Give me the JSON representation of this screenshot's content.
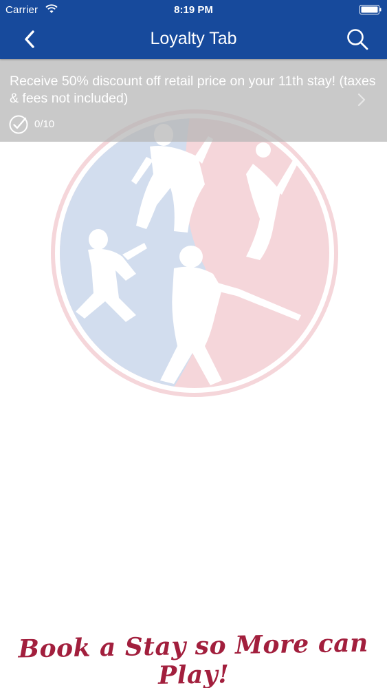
{
  "status_bar": {
    "carrier": "Carrier",
    "time": "8:19 PM"
  },
  "nav": {
    "title": "Loyalty Tab",
    "back_icon": "chevron-left-icon",
    "search_icon": "search-icon"
  },
  "offer": {
    "description": "Receive 50% discount off retail price on your 11th stay! (taxes & fees not included)",
    "progress_label": "0/10",
    "progress": {
      "completed": 0,
      "total": 10
    }
  },
  "slogan": "Book a Stay so More can Play!",
  "colors": {
    "nav_bar": "#174a9c",
    "slogan": "#a21f3d",
    "watermark_blue": "#7f9fd0",
    "watermark_red": "#e58b98"
  }
}
